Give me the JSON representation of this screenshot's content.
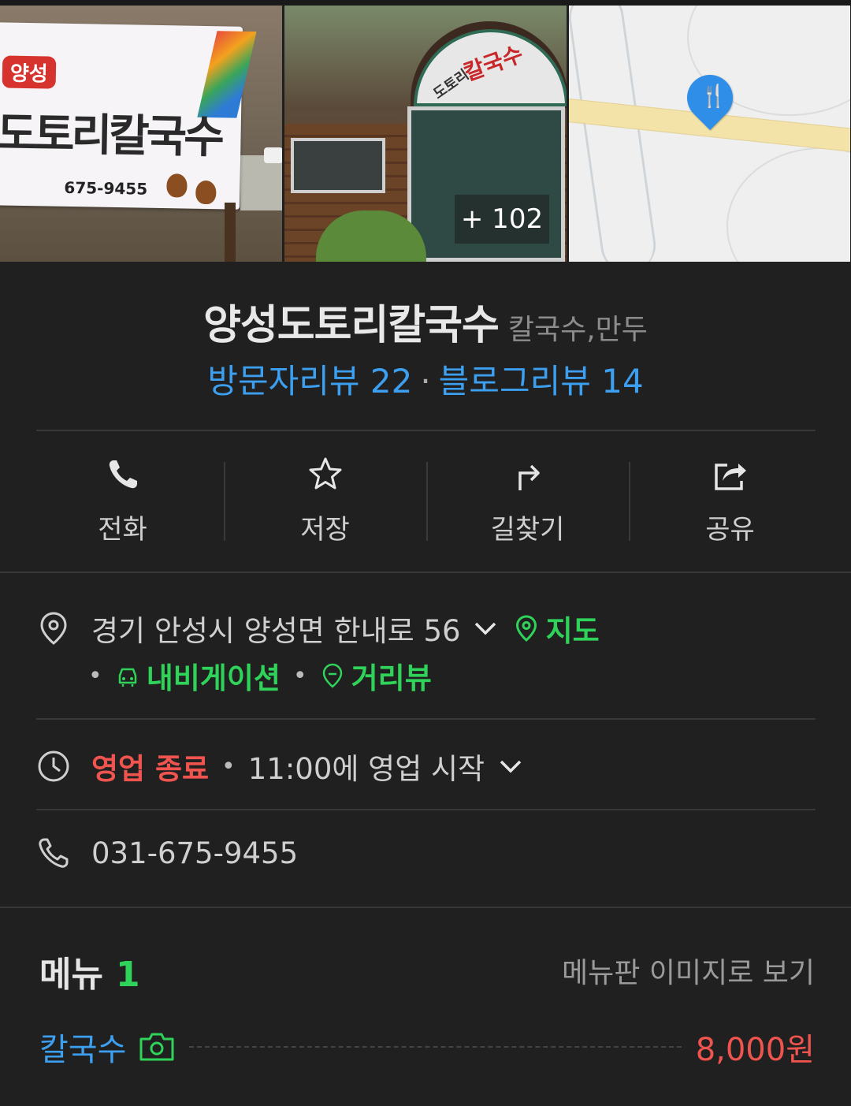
{
  "photos": {
    "sign_tag": "양성",
    "sign_name": "도토리칼국수",
    "sign_phone": "675-9455",
    "building_sign_red": "칼국수",
    "building_sign_green": "도토리",
    "more_count": "+ 102"
  },
  "place": {
    "name": "양성도토리칼국수",
    "category": "칼국수,만두",
    "visitor_reviews": "방문자리뷰 22",
    "blog_reviews": "블로그리뷰 14"
  },
  "actions": [
    {
      "label": "전화",
      "icon": "phone-icon"
    },
    {
      "label": "저장",
      "icon": "star-icon"
    },
    {
      "label": "길찾기",
      "icon": "directions-icon"
    },
    {
      "label": "공유",
      "icon": "share-icon"
    }
  ],
  "info": {
    "address": "경기 안성시 양성면 한내로 56",
    "map_link": "지도",
    "navigation_link": "내비게이션",
    "street_view_link": "거리뷰",
    "status": "영업 종료",
    "hours": "11:00에 영업 시작",
    "phone": "031-675-9455"
  },
  "menu": {
    "title": "메뉴",
    "count": "1",
    "board_link": "메뉴판 이미지로 보기",
    "items": [
      {
        "name": "칼국수",
        "price": "8,000원"
      }
    ]
  },
  "colors": {
    "background": "#202020",
    "link_blue": "#3d9ff0",
    "accent_green": "#2fd35a",
    "status_red": "#f0544f"
  }
}
